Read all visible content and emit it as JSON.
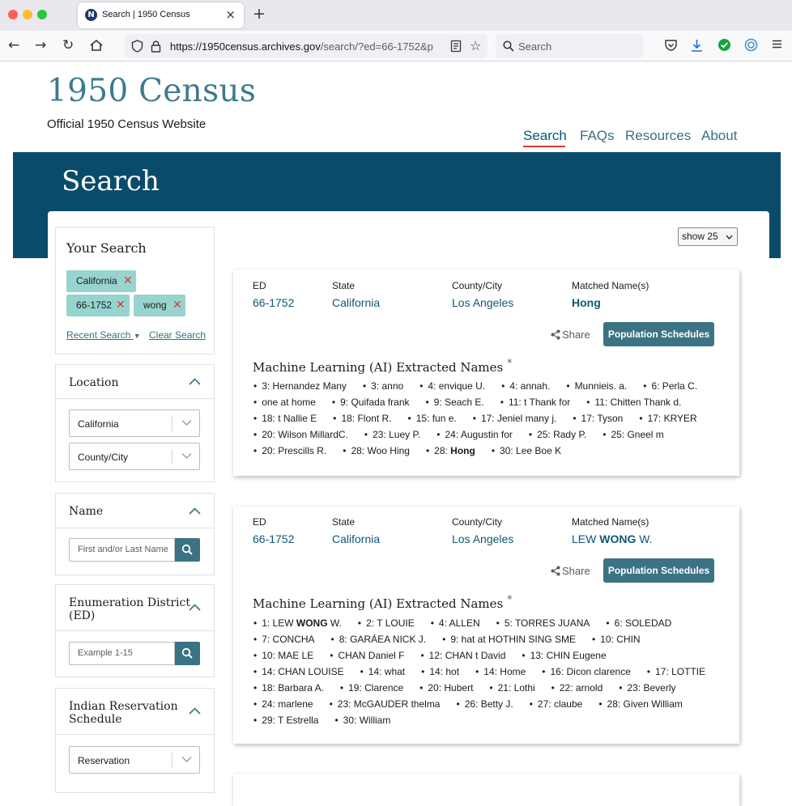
{
  "browser": {
    "tab_title": "Search | 1950 Census",
    "favicon": "N",
    "url_domain": "https://1950census.archives.gov",
    "url_path": "/search/?ed=66-1752&p",
    "search_placeholder": "Search"
  },
  "site": {
    "title": "1950 Census",
    "subtitle": "Official 1950 Census Website",
    "nav": [
      "Search",
      "FAQs",
      "Resources",
      "About"
    ],
    "banner_title": "Search",
    "accent_color": "#d83933",
    "brand_color": "#0a4b6a"
  },
  "sidebar": {
    "your_search": {
      "title": "Your Search",
      "chips": [
        "California",
        "66-1752",
        "wong"
      ],
      "recent_label": "Recent Search",
      "clear_label": "Clear Search"
    },
    "location": {
      "title": "Location",
      "state_value": "California",
      "county_placeholder": "County/City"
    },
    "name": {
      "title": "Name",
      "placeholder": "First and/or Last Name"
    },
    "ed": {
      "title": "Enumeration District (ED)",
      "placeholder": "Example 1-15"
    },
    "reservation": {
      "title": "Indian Reservation Schedule",
      "placeholder": "Reservation"
    }
  },
  "results": {
    "show_label": "show 25",
    "field_labels": {
      "ed": "ED",
      "state": "State",
      "county": "County/City",
      "matched": "Matched Name(s)"
    },
    "share_label": "Share",
    "pop_label": "Population Schedules",
    "ml_title": "Machine Learning (AI) Extracted Names",
    "ml_star": "*",
    "cards": [
      {
        "ed": "66-1752",
        "state": "California",
        "county": "Los Angeles",
        "matched_pre": "",
        "matched_bold": "Hong",
        "matched_post": "",
        "names": [
          "3: Hernandez Many",
          "3: anno",
          "4: envique U.",
          "4: annah.",
          "Munnieis. a.",
          "6: Perla C.",
          "one at home",
          "9: Quifada frank",
          "9: Seach E.",
          "11: t Thank for",
          "11: Chitten Thank d.",
          "18: t Nallie E",
          "18: Flont R.",
          "15: fun e.",
          "17: Jeniel many j.",
          "17: Tyson",
          "17: KRYER",
          "20: Wilson MillardC.",
          "23: Luey P.",
          "24: Augustin for",
          "25: Rady P.",
          "25: Gneel m",
          "20: Prescills R.",
          "28: Woo Hing",
          "28: |Hong|",
          "30: Lee Boe K"
        ]
      },
      {
        "ed": "66-1752",
        "state": "California",
        "county": "Los Angeles",
        "matched_pre": "LEW ",
        "matched_bold": "WONG",
        "matched_post": " W.",
        "names": [
          "1: LEW |WONG| W.",
          "2: T LOUIE",
          "4: ALLEN",
          "5: TORRES JUANA",
          "6: SOLEDAD",
          "7: CONCHA",
          "8: GARÁEA NICK J.",
          "9: hat at HOTHIN SING SME",
          "10: CHIN",
          "10: MAE LE",
          "CHAN Daniel F",
          "12: CHAN t David",
          "13: CHIN Eugene",
          "14: CHAN LOUISE",
          "14: what",
          "14: hot",
          "14: Home",
          "16: Dicon clarence",
          "17: LOTTIE",
          "18: Barbara A.",
          "19: Clarence",
          "20: Hubert",
          "21: Lothi",
          "22: arnold",
          "23: Beverly",
          "24: marlene",
          "23: McGAUDER thelma",
          "26: Betty J.",
          "27: claube",
          "28: Given William",
          "29: T Estrella",
          "30: William"
        ]
      }
    ]
  }
}
